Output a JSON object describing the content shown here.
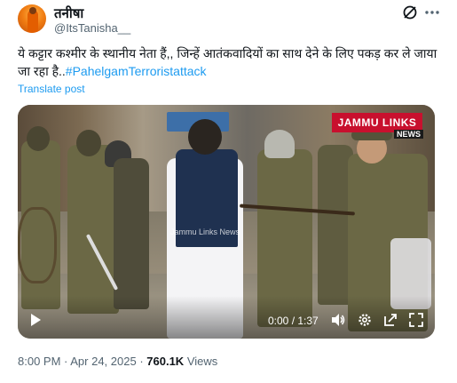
{
  "author": {
    "display_name": "तनीषा",
    "handle": "@ItsTanisha__"
  },
  "tweet": {
    "text": "ये कट्टार कश्मीर के स्थानीय नेता हैं,, जिन्हें आतंकवादियों का साथ देने के लिए पकड़ कर ले जाया जा रहा है..",
    "hashtag": "#PahelgamTerroristattack",
    "translate_label": "Translate post"
  },
  "video": {
    "watermark": "JAMMU LINKS",
    "watermark_sub": "NEWS",
    "caption_overlay": "Jammu Links News",
    "time_display": "0:00 / 1:37"
  },
  "meta": {
    "datetime": "8:00 PM · Apr 24, 2025",
    "separator": " · ",
    "views_count": "760.1K",
    "views_label": "Views"
  },
  "icons": {
    "grok": "grok-icon",
    "more": "more-icon",
    "play": "play-icon",
    "volume": "volume-icon",
    "settings": "settings-icon",
    "popout": "popout-icon",
    "fullscreen": "fullscreen-icon"
  },
  "colors": {
    "link": "#1d9bf0",
    "secondary_text": "#536471",
    "watermark_red": "#c8102e"
  }
}
